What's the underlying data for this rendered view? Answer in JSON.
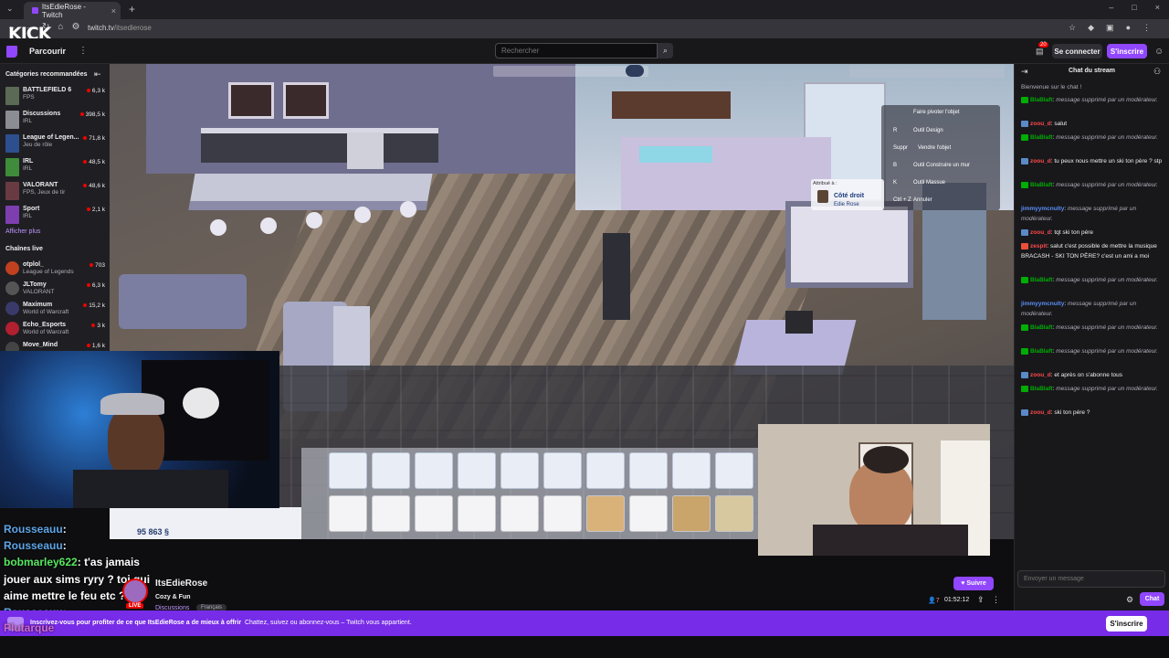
{
  "browser": {
    "tab_title": "ItsEdieRose - Twitch",
    "url_host": "twitch.tv",
    "url_path": "/itsedierose",
    "extension_logo": "KICK"
  },
  "topbar": {
    "browse_label": "Parcourir",
    "search_placeholder": "Rechercher",
    "notif_count": "20",
    "login_label": "Se connecter",
    "signup_label": "S'inscrire"
  },
  "sidebar": {
    "recommended_heading": "Catégories recommandées",
    "categories": [
      {
        "name": "BATTLEFIELD 6",
        "sub": "FPS",
        "viewers": "6,3 k"
      },
      {
        "name": "Discussions",
        "sub": "IRL",
        "viewers": "398,5 k"
      },
      {
        "name": "League of Legen...",
        "sub": "Jeu de rôle",
        "viewers": "71,8 k"
      },
      {
        "name": "IRL",
        "sub": "IRL",
        "viewers": "48,5 k"
      },
      {
        "name": "VALORANT",
        "sub": "FPS, Jeux de tir",
        "viewers": "48,6 k"
      },
      {
        "name": "Sport",
        "sub": "IRL",
        "viewers": "2,1 k"
      }
    ],
    "show_more": "Afficher plus",
    "live_heading": "Chaînes live",
    "channels": [
      {
        "name": "otplol_",
        "sub": "League of Legends",
        "viewers": "703"
      },
      {
        "name": "JLTomy",
        "sub": "VALORANT",
        "viewers": "6,3 k"
      },
      {
        "name": "Maximum",
        "sub": "World of Warcraft",
        "viewers": "15,2 k"
      },
      {
        "name": "Echo_Esports",
        "sub": "World of Warcraft",
        "viewers": "3 k"
      },
      {
        "name": "Move_Mind",
        "sub": "",
        "viewers": "1,6 k"
      }
    ]
  },
  "game": {
    "tools": [
      {
        "key": "",
        "label": "Faire pivoter l'objet"
      },
      {
        "key": "R",
        "label": "Outil Design"
      },
      {
        "key": "Suppr",
        "label": "Vendre l'objet"
      },
      {
        "key": "B",
        "label": "Outil Construire un mur"
      },
      {
        "key": "K",
        "label": "Outil Massue"
      },
      {
        "key": "Ctrl + Z",
        "label": "Annuler"
      }
    ],
    "assigned_label": "Attribué à :",
    "assigned_item": "Côté droit",
    "assigned_sim": "Edie Rose",
    "funds": "95 863 §"
  },
  "overlay_chat": [
    {
      "user": "Rousseauu",
      "text": ""
    },
    {
      "user": "Rousseauu",
      "text": ""
    },
    {
      "user": "bobmarley622",
      "text": "t'as jamais"
    },
    {
      "user": "",
      "text": "jouer aux sims ryry ? toi qui"
    },
    {
      "user": "",
      "text": "aime mettre le feu etc ?"
    },
    {
      "user": "Rousseauu",
      "text": ""
    },
    {
      "user": "Plutarque",
      "text": ""
    }
  ],
  "channel": {
    "name": "ItsEdieRose",
    "title": "Cozy & Fun",
    "category": "Discussions",
    "tag": "Français",
    "follow_label": "Suivre",
    "viewers": "7",
    "uptime": "01:52:12"
  },
  "chat": {
    "title": "Chat du stream",
    "welcome": "Bienvenue sur le chat !",
    "messages": [
      {
        "user": "BlaBlaft",
        "text": "message supprimé par un modérateur.",
        "deleted": true
      },
      {
        "user": "zoou_d",
        "text": "salut",
        "deleted": false
      },
      {
        "user": "BlaBlaft",
        "text": "message supprimé par un modérateur.",
        "deleted": true
      },
      {
        "user": "zoou_d",
        "text": "tu peux nous mettre un ski ton père ? stp",
        "deleted": false
      },
      {
        "user": "BlaBlaft",
        "text": "message supprimé par un modérateur.",
        "deleted": true
      },
      {
        "user": "jimmyymcnulty",
        "text": "message supprimé par un modérateur.",
        "deleted": true
      },
      {
        "user": "zoou_d",
        "text": "tqt ski ton pére",
        "deleted": false
      },
      {
        "user": "zespit",
        "text": "salut c'est possible de mettre la musique BRACASH - SKI TON PÈRE? c'est un ami a moi",
        "deleted": false
      },
      {
        "user": "BlaBlaft",
        "text": "message supprimé par un modérateur.",
        "deleted": true
      },
      {
        "user": "jimmyymcnulty",
        "text": "message supprimé par un modérateur.",
        "deleted": true
      },
      {
        "user": "BlaBlaft",
        "text": "message supprimé par un modérateur.",
        "deleted": true
      },
      {
        "user": "BlaBlaft",
        "text": "message supprimé par un modérateur.",
        "deleted": true
      },
      {
        "user": "zoou_d",
        "text": "et après on s'abonne tous",
        "deleted": false
      },
      {
        "user": "BlaBlaft",
        "text": "message supprimé par un modérateur.",
        "deleted": true
      },
      {
        "user": "zoou_d",
        "text": "ski ton pére ?",
        "deleted": false
      }
    ],
    "input_placeholder": "Envoyer un message",
    "send_label": "Chat"
  },
  "banner": {
    "text_bold": "Inscrivez-vous pour profiter de ce que ItsEdieRose a de mieux à offrir",
    "text_rest": "Chattez, suivez ou abonnez-vous – Twitch vous appartient.",
    "button": "S'inscrire"
  },
  "colors": {
    "twitch_purple": "#9147ff",
    "live_red": "#eb0400",
    "bg_dark": "#0e0e10",
    "panel": "#18181b"
  }
}
